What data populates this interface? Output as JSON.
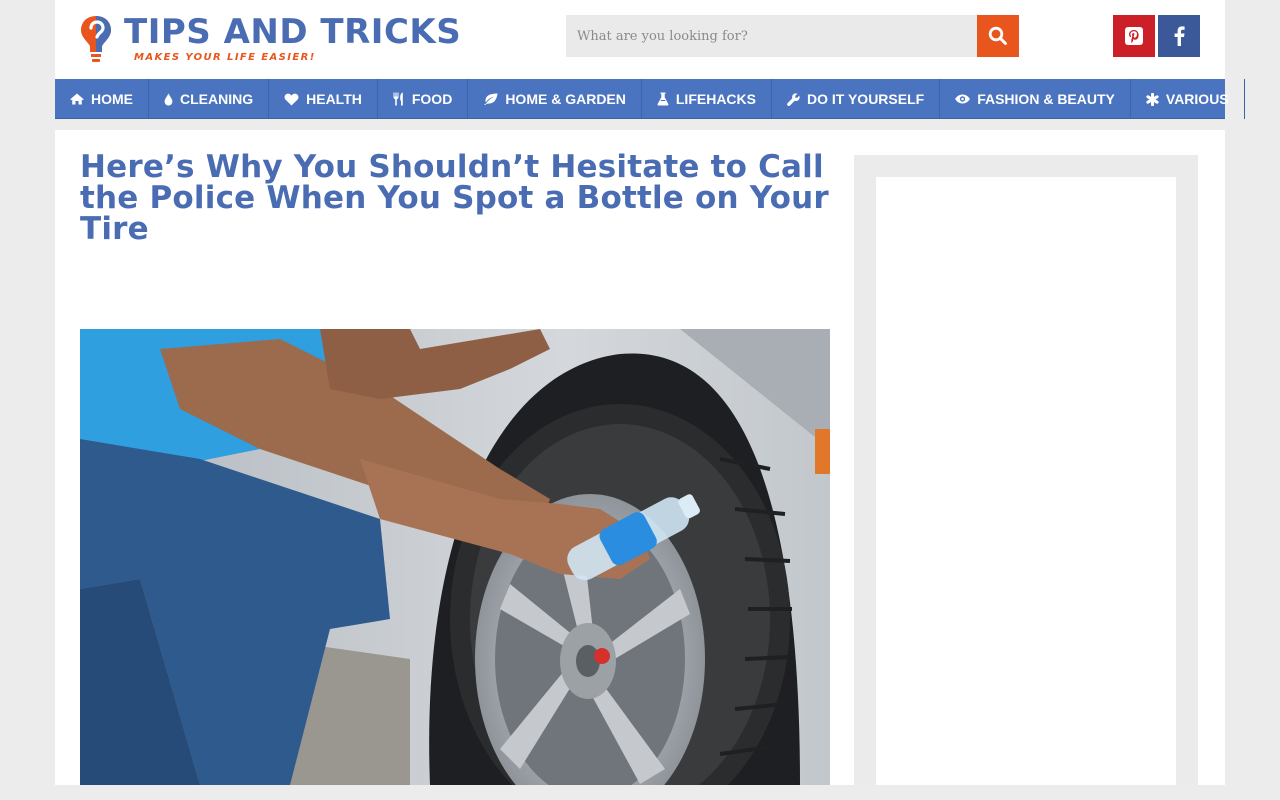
{
  "header": {
    "logo_title": "TIPS AND TRICKS",
    "logo_tagline": "MAKES YOUR LIFE EASIER!",
    "search_placeholder": "What are you looking for?",
    "search_icon": "search-icon",
    "social": [
      {
        "name": "pinterest",
        "icon": "pinterest-icon",
        "color": "#cb2027"
      },
      {
        "name": "facebook",
        "icon": "facebook-icon",
        "color": "#3b5998"
      }
    ]
  },
  "nav": {
    "items": [
      {
        "label": "HOME",
        "icon": "home-icon"
      },
      {
        "label": "CLEANING",
        "icon": "droplet-icon"
      },
      {
        "label": "HEALTH",
        "icon": "heart-icon"
      },
      {
        "label": "FOOD",
        "icon": "cutlery-icon"
      },
      {
        "label": "HOME & GARDEN",
        "icon": "leaf-icon"
      },
      {
        "label": "LIFEHACKS",
        "icon": "flask-icon"
      },
      {
        "label": "DO IT YOURSELF",
        "icon": "wrench-icon"
      },
      {
        "label": "FASHION & BEAUTY",
        "icon": "eye-icon"
      },
      {
        "label": "VARIOUS",
        "icon": "asterisk-icon"
      }
    ]
  },
  "article": {
    "title": "Here’s Why You Shouldn’t Hesitate to Call the Police When You Spot a Bottle on Your Tire"
  },
  "colors": {
    "brand_blue": "#4a6cb3",
    "nav_blue": "#4a73c0",
    "accent_orange": "#e8561e"
  }
}
